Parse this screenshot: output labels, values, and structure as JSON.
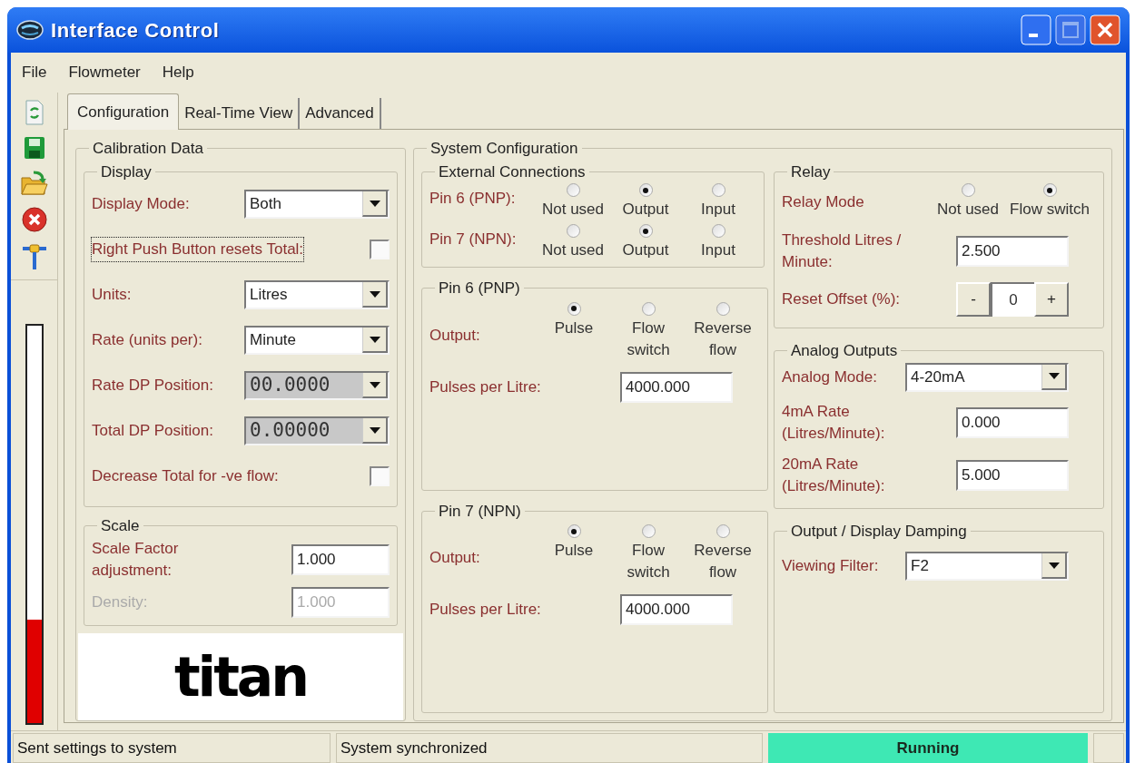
{
  "window": {
    "title": "Interface Control"
  },
  "menu": [
    {
      "label": "File"
    },
    {
      "label": "Flowmeter"
    },
    {
      "label": "Help"
    }
  ],
  "flow_bar": {
    "level": 0.26
  },
  "tabs": [
    {
      "label": "Configuration",
      "selected": true
    },
    {
      "label": "Real-Time View",
      "selected": false
    },
    {
      "label": "Advanced",
      "selected": false
    }
  ],
  "calibration": {
    "title": "Calibration Data",
    "display": {
      "title": "Display",
      "rows": [
        {
          "kind": "dropdown",
          "label": "Display Mode:",
          "value": "Both",
          "disabled": false
        },
        {
          "kind": "checkbox",
          "label": "Right Push Button resets Total:",
          "checked": false,
          "focused": true
        },
        {
          "kind": "dropdown",
          "label": "Units:",
          "value": "Litres",
          "disabled": false
        },
        {
          "kind": "dropdown",
          "label": "Rate (units per):",
          "value": "Minute",
          "disabled": false
        },
        {
          "kind": "dropdown",
          "label": "Rate DP Position:",
          "value": "00.0000",
          "disabled": true
        },
        {
          "kind": "dropdown",
          "label": "Total DP Position:",
          "value": "0.00000",
          "disabled": true
        },
        {
          "kind": "checkbox",
          "label": "Decrease Total for -ve flow:",
          "checked": false,
          "focused": false
        }
      ]
    },
    "scale": {
      "title": "Scale",
      "rows": [
        {
          "label": "Scale Factor adjustment:",
          "value": "1.000",
          "disabled": false
        },
        {
          "label": "Density:",
          "value": "1.000",
          "disabled": true
        }
      ]
    },
    "logo": "titan"
  },
  "system": {
    "title": "System Configuration",
    "external": {
      "title": "External Connections",
      "rows": [
        {
          "label": "Pin 6 (PNP):",
          "options": [
            {
              "label": "Not used",
              "selected": false
            },
            {
              "label": "Output",
              "selected": true
            },
            {
              "label": "Input",
              "selected": false
            }
          ]
        },
        {
          "label": "Pin 7 (NPN):",
          "options": [
            {
              "label": "Not used",
              "selected": false
            },
            {
              "label": "Output",
              "selected": true
            },
            {
              "label": "Input",
              "selected": false
            }
          ]
        }
      ]
    },
    "outputs": [
      {
        "title": "Pin 6 (PNP)",
        "output_label": "Output:",
        "options": [
          {
            "label": "Pulse",
            "selected": true
          },
          {
            "label": "Flow switch",
            "selected": false
          },
          {
            "label": "Reverse flow",
            "selected": false
          }
        ],
        "pulses_label": "Pulses per Litre:",
        "pulses_value": "4000.000"
      },
      {
        "title": "Pin 7 (NPN)",
        "output_label": "Output:",
        "options": [
          {
            "label": "Pulse",
            "selected": true
          },
          {
            "label": "Flow switch",
            "selected": false
          },
          {
            "label": "Reverse flow",
            "selected": false
          }
        ],
        "pulses_label": "Pulses per Litre:",
        "pulses_value": "4000.000"
      }
    ],
    "relay": {
      "title": "Relay",
      "mode_label": "Relay Mode",
      "options": [
        {
          "label": "Not used",
          "selected": false
        },
        {
          "label": "Flow switch",
          "selected": true
        }
      ],
      "threshold_label": "Threshold Litres / Minute:",
      "threshold_value": "2.500",
      "offset_label": "Reset Offset (%):",
      "decrement": "-",
      "offset_value": "0",
      "increment": "+"
    },
    "analog": {
      "title": "Analog Outputs",
      "rows": [
        {
          "kind": "dropdown",
          "label": "Analog Mode:",
          "value": "4-20mA"
        },
        {
          "kind": "field",
          "label": "4mA Rate (Litres/Minute):",
          "value": "0.000"
        },
        {
          "kind": "field",
          "label": "20mA Rate (Litres/Minute):",
          "value": "5.000"
        }
      ]
    },
    "damping": {
      "title": "Output / Display Damping",
      "rows": [
        {
          "kind": "dropdown",
          "label": "Viewing Filter:",
          "value": "F2"
        }
      ]
    }
  },
  "status_bar": [
    {
      "kind": "text",
      "text": "Sent settings to system"
    },
    {
      "kind": "text",
      "text": "System synchronized"
    },
    {
      "kind": "indicator",
      "text": "Running"
    }
  ]
}
